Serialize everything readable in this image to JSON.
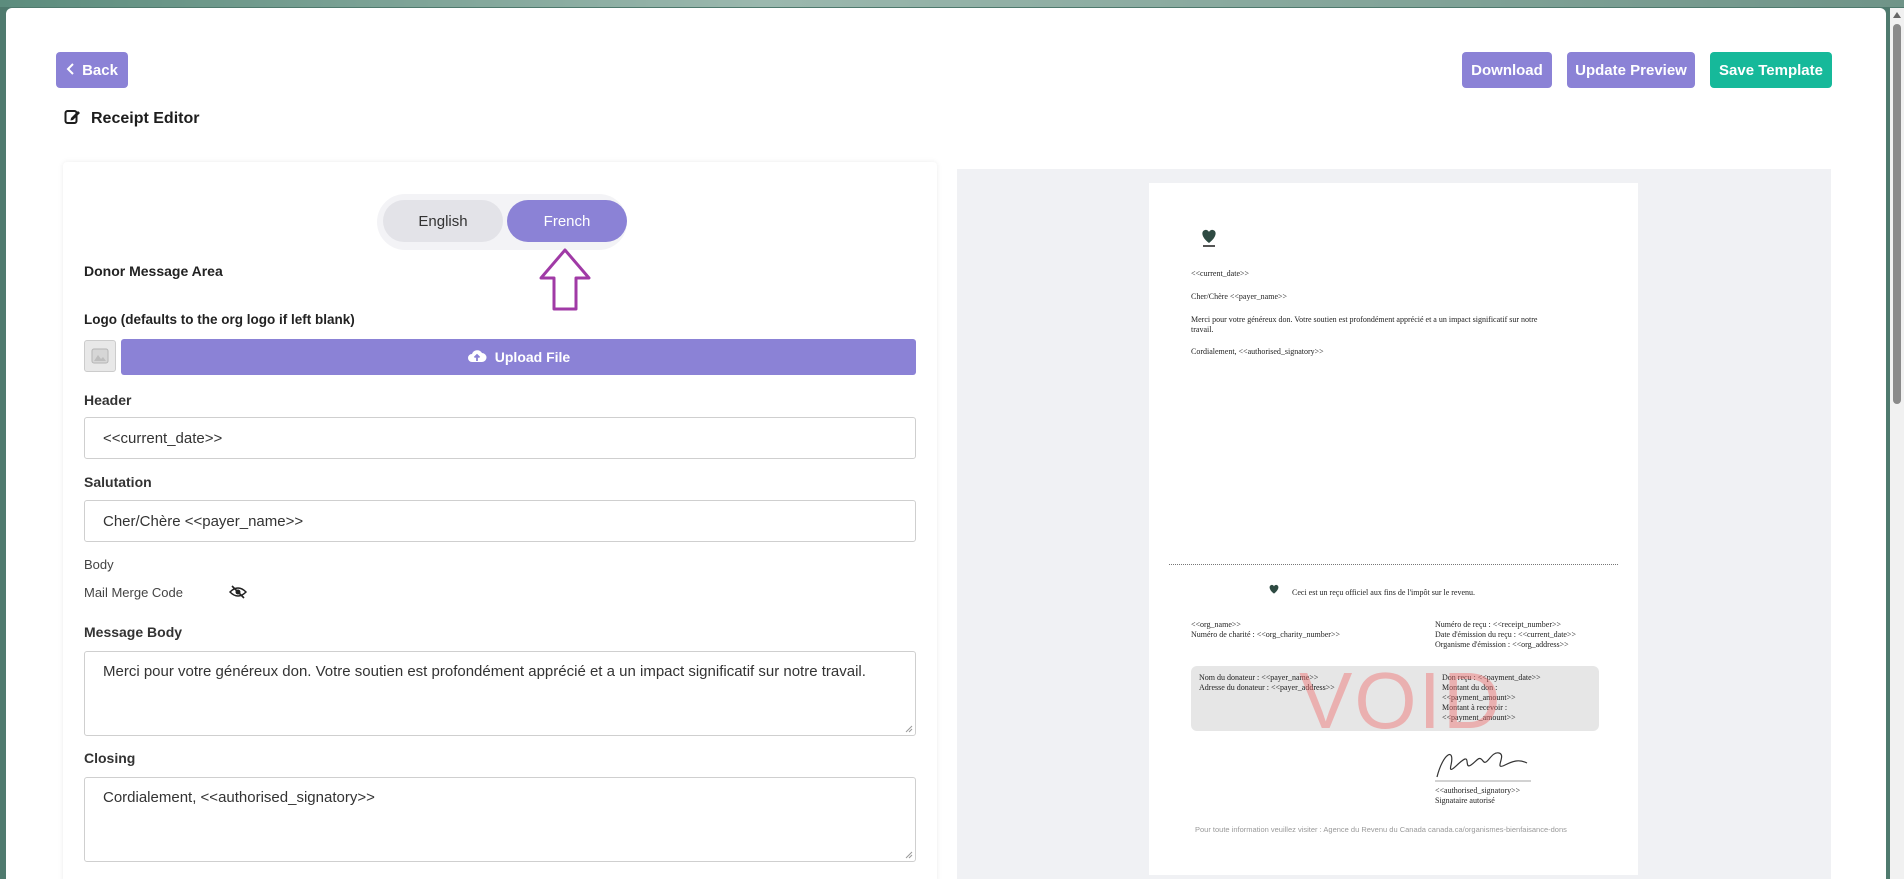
{
  "header": {
    "back_label": "Back",
    "title": "Receipt Editor",
    "download_label": "Download",
    "update_preview_label": "Update Preview",
    "save_template_label": "Save Template"
  },
  "language": {
    "english_label": "English",
    "french_label": "French",
    "selected": "French"
  },
  "form": {
    "section_title": "Donor Message Area",
    "logo_label": "Logo (defaults to the org logo if left blank)",
    "upload_label": "Upload File",
    "header_label": "Header",
    "header_value": "<<current_date>>",
    "salutation_label": "Salutation",
    "salutation_value": "Cher/Chère <<payer_name>>",
    "body_label": "Body",
    "mail_merge_label": "Mail Merge Code",
    "message_body_label": "Message Body",
    "message_body_value": "Merci pour votre généreux don. Votre soutien est profondément apprécié et a un impact significatif sur notre travail.",
    "closing_label": "Closing",
    "closing_value": "Cordialement, <<authorised_signatory>>"
  },
  "preview": {
    "date": "<<current_date>>",
    "salutation": "Cher/Chère <<payer_name>>",
    "body_line1": "Merci pour votre généreux don. Votre soutien est profondément apprécié et a un impact significatif sur notre",
    "body_line2": "travail.",
    "closing": "Cordialement, <<authorised_signatory>>",
    "official_notice": "Ceci est un reçu officiel aux fins de l'impôt sur le revenu.",
    "org_name": "<<org_name>>",
    "charity_number": "Numéro de charité : <<org_charity_number>>",
    "receipt_number": "Numéro de reçu : <<receipt_number>>",
    "issue_date": "Date d'émission du reçu : <<current_date>>",
    "issuing_org": "Organisme d'émission : <<org_address>>",
    "donor_name": "Nom du donateur : <<payer_name>>",
    "donor_address": "Adresse du donateur : <<payer_address>>",
    "donation_received": "Don reçu : <<payment_date>>",
    "donation_amount_label": "Montant du don :",
    "donation_amount_value": "<<payment_amount>>",
    "amount_to_receive_label": "Montant à recevoir :",
    "amount_to_receive_value": "<<payment_amount>>",
    "void_watermark": "VOID",
    "signatory": "<<authorised_signatory>>",
    "signatory_title": "Signataire autorisé",
    "footer": "Pour toute information veuillez visiter : Agence du Revenu du Canada canada.ca/organismes-bienfaisance-dons"
  },
  "colors": {
    "accent_purple": "#8b82d6",
    "accent_teal": "#16b99a",
    "annotation_arrow": "#a03aa6"
  }
}
